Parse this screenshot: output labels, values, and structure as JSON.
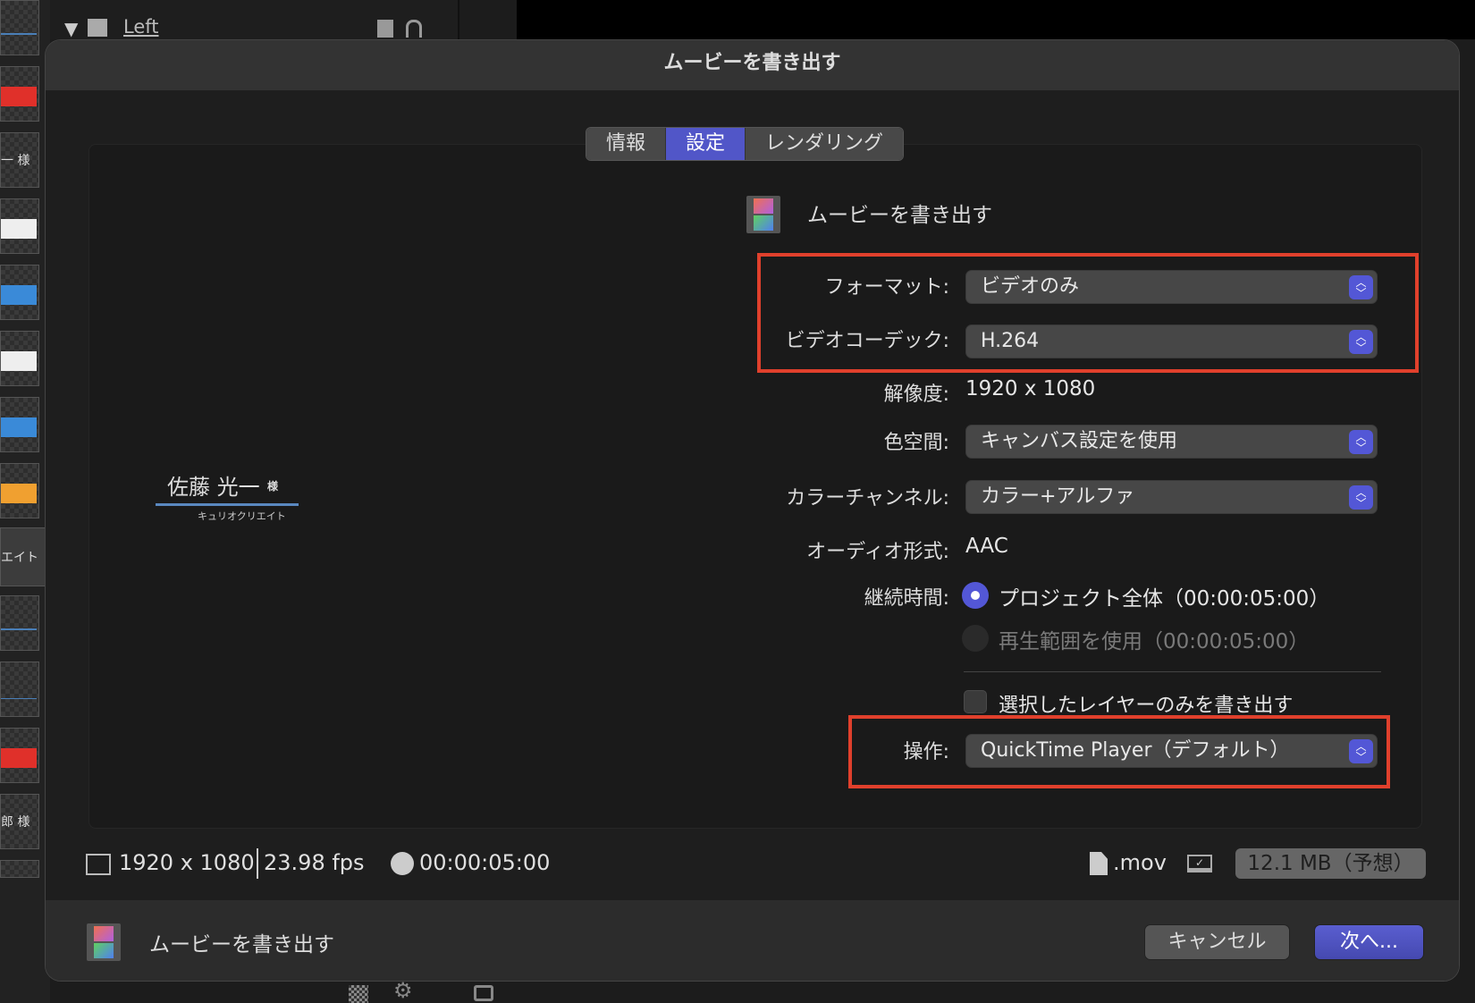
{
  "background": {
    "layer_name": "Left",
    "thumbnail_texts": [
      "一 様",
      "エイト",
      "郎 様"
    ]
  },
  "dialog": {
    "title": "ムービーを書き出す",
    "tabs": [
      {
        "label": "情報",
        "active": false
      },
      {
        "label": "設定",
        "active": true
      },
      {
        "label": "レンダリング",
        "active": false
      }
    ],
    "preview": {
      "name": "佐藤 光一",
      "honorific": "様",
      "company": "キュリオクリエイト"
    },
    "preset_title": "ムービーを書き出す",
    "settings": {
      "format_label": "フォーマット:",
      "format_value": "ビデオのみ",
      "codec_label": "ビデオコーデック:",
      "codec_value": "H.264",
      "resolution_label": "解像度:",
      "resolution_value": "1920 x 1080",
      "colorspace_label": "色空間:",
      "colorspace_value": "キャンバス設定を使用",
      "channels_label": "カラーチャンネル:",
      "channels_value": "カラー+アルファ",
      "audio_label": "オーディオ形式:",
      "audio_value": "AAC",
      "duration_label": "継続時間:",
      "duration_option1": "プロジェクト全体（00:00:05:00）",
      "duration_option2": "再生範囲を使用（00:00:05:00）",
      "selected_layers_label": "選択したレイヤーのみを書き出す",
      "action_label": "操作:",
      "action_value": "QuickTime Player（デフォルト）"
    },
    "info": {
      "resolution": "1920 x 1080",
      "fps": "23.98 fps",
      "duration": "00:00:05:00",
      "extension": ".mov",
      "size_estimate": "12.1 MB（予想）"
    },
    "bottom": {
      "title": "ムービーを書き出す",
      "cancel": "キャンセル",
      "next": "次へ..."
    }
  },
  "colors": {
    "accent": "#5357d6",
    "highlight": "#e0402c"
  }
}
